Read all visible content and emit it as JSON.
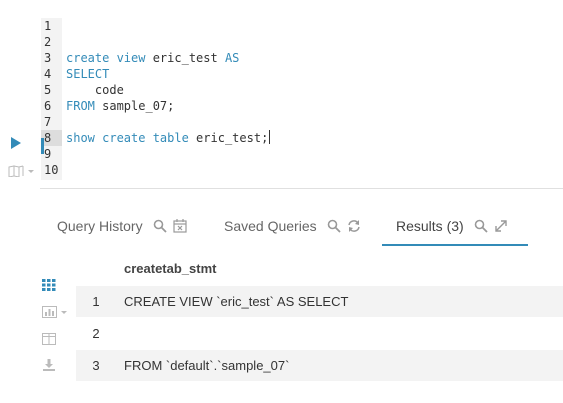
{
  "editor": {
    "line_numbers": [
      "1",
      "2",
      "3",
      "4",
      "5",
      "6",
      "7",
      "8",
      "9",
      "10"
    ],
    "active_line": "8",
    "lines": [
      {
        "parts": []
      },
      {
        "parts": []
      },
      {
        "parts": [
          {
            "t": "create view ",
            "k": true
          },
          {
            "t": "eric_test ",
            "k": false
          },
          {
            "t": "AS",
            "k": true
          }
        ]
      },
      {
        "parts": [
          {
            "t": "SELECT",
            "k": true
          }
        ]
      },
      {
        "parts": [
          {
            "t": "    code",
            "k": false
          }
        ]
      },
      {
        "parts": [
          {
            "t": "FROM ",
            "k": true
          },
          {
            "t": "sample_07;",
            "k": false
          }
        ]
      },
      {
        "parts": []
      },
      {
        "parts": [
          {
            "t": "show create table ",
            "k": true
          },
          {
            "t": "eric_test;",
            "k": false
          }
        ]
      },
      {
        "parts": []
      },
      {
        "parts": []
      }
    ]
  },
  "tabs": {
    "query_history": "Query History",
    "saved_queries": "Saved Queries",
    "results": "Results (3)"
  },
  "results": {
    "column": "createtab_stmt",
    "rows": [
      {
        "num": "1",
        "value": "CREATE VIEW `eric_test` AS SELECT"
      },
      {
        "num": "2",
        "value": ""
      },
      {
        "num": "3",
        "value": "FROM `default`.`sample_07`"
      }
    ]
  },
  "colors": {
    "accent": "#338bb8",
    "keyword": "#338bb8",
    "icon_gray": "#999999"
  }
}
